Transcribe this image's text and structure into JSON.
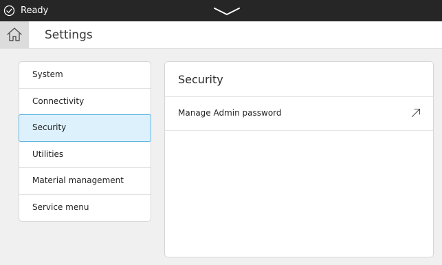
{
  "status_bar": {
    "status_text": "Ready",
    "status_icon": "checkmark-circle-icon",
    "pulldown_icon": "chevron-down-icon"
  },
  "header": {
    "home_icon": "home-icon",
    "title": "Settings"
  },
  "sidebar": {
    "items": [
      {
        "label": "System"
      },
      {
        "label": "Connectivity"
      },
      {
        "label": "Security"
      },
      {
        "label": "Utilities"
      },
      {
        "label": "Material management"
      },
      {
        "label": "Service menu"
      }
    ],
    "selected_label": "Security"
  },
  "panel": {
    "title": "Security",
    "rows": [
      {
        "label": "Manage Admin password",
        "icon": "external-arrow-icon"
      }
    ]
  },
  "colors": {
    "status_bar": "#262626",
    "selected_background": "#dcf1fb",
    "selected_border": "#5fb6e4",
    "page_background": "#f0f0f0"
  }
}
